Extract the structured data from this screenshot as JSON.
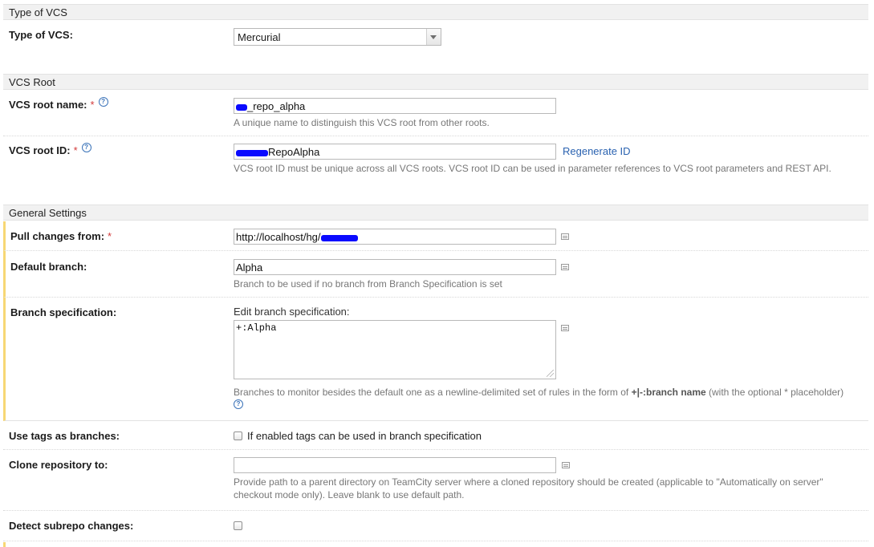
{
  "sections": {
    "type_of_vcs": "Type of VCS",
    "vcs_root": "VCS Root",
    "general_settings": "General Settings"
  },
  "type_of_vcs": {
    "label": "Type of VCS:",
    "selected": "Mercurial"
  },
  "vcs_root_name": {
    "label": "VCS root name:",
    "required": "*",
    "value": "_repo_alpha",
    "hint": "A unique name to distinguish this VCS root from other roots."
  },
  "vcs_root_id": {
    "label": "VCS root ID:",
    "required": "*",
    "value": "RepoAlpha",
    "link": "Regenerate ID",
    "hint": "VCS root ID must be unique across all VCS roots. VCS root ID can be used in parameter references to VCS root parameters and REST API."
  },
  "pull_changes": {
    "label": "Pull changes from:",
    "required": "*",
    "value": "http://localhost/hg/"
  },
  "default_branch": {
    "label": "Default branch:",
    "value": "Alpha",
    "hint": "Branch to be used if no branch from Branch Specification is set"
  },
  "branch_spec": {
    "label": "Branch specification:",
    "edit_label": "Edit branch specification:",
    "value": "+:Alpha",
    "hint_prefix": "Branches to monitor besides the default one as a newline-delimited set of rules in the form of",
    "hint_bold": "+|-:branch name",
    "hint_suffix": "(with the optional * placeholder)"
  },
  "use_tags": {
    "label": "Use tags as branches:",
    "checkbox_text": "If enabled tags can be used in branch specification"
  },
  "clone_repo": {
    "label": "Clone repository to:",
    "value": "",
    "hint_line1": "Provide path to a parent directory on TeamCity server where a cloned repository should be created (applicable to \"Automatically on server\"",
    "hint_line2": "checkout mode only). Leave blank to use default path."
  },
  "detect_subrepo": {
    "label": "Detect subrepo changes:"
  },
  "help": "?"
}
